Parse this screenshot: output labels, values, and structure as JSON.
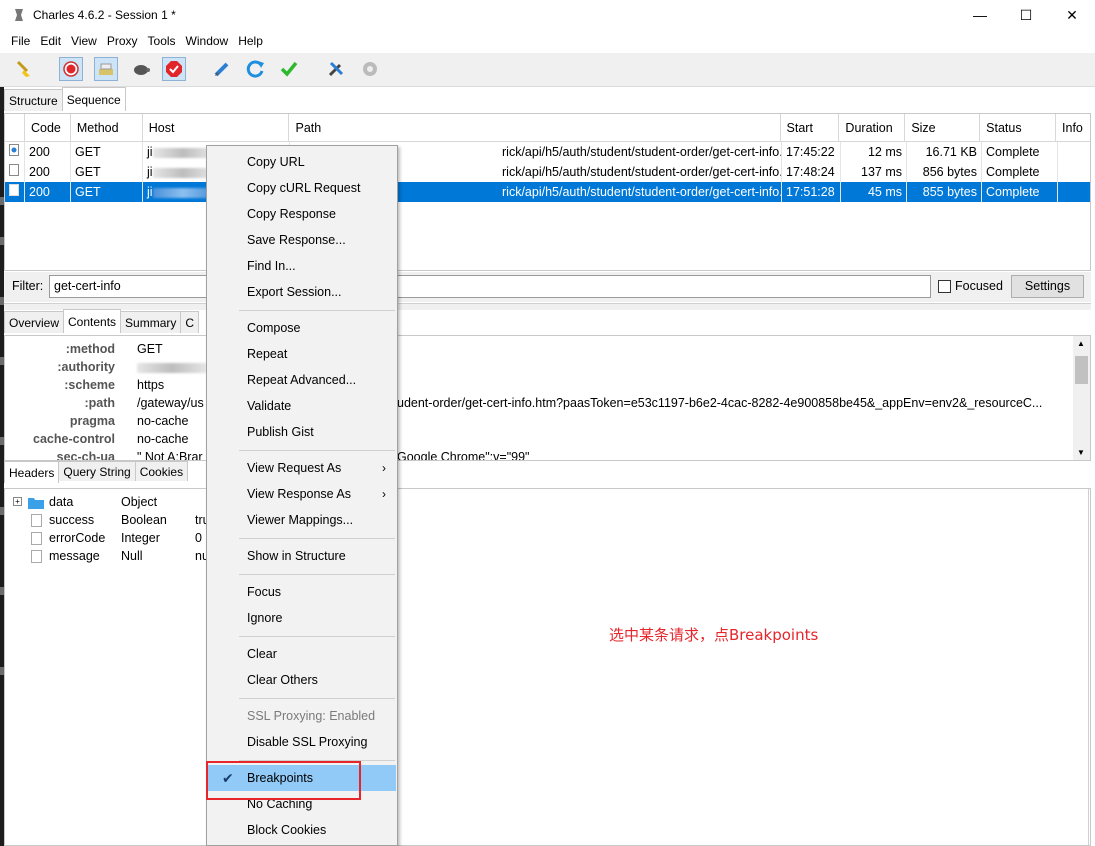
{
  "window": {
    "title": "Charles 4.6.2 - Session 1 *",
    "controls": [
      "—",
      "☐",
      "✕"
    ]
  },
  "menu": [
    "File",
    "Edit",
    "View",
    "Proxy",
    "Tools",
    "Window",
    "Help"
  ],
  "toolbar": {
    "buttons": [
      "broom-icon",
      "record-icon",
      "throttle-icon",
      "turtle-icon",
      "breakpoints-icon",
      "compose-icon",
      "repeat-icon",
      "validate-icon",
      "tools-icon",
      "settings-icon"
    ]
  },
  "main_tabs": [
    "Structure",
    "Sequence"
  ],
  "table": {
    "columns": [
      "Code",
      "Method",
      "Host",
      "Path",
      "Start",
      "Duration",
      "Size",
      "Status",
      "Info"
    ],
    "rows": [
      {
        "code": "200",
        "method": "GET",
        "host": "ji",
        "path": "rick/api/h5/auth/student/student-order/get-cert-info.htm?paasT...",
        "start": "17:45:22",
        "duration": "12 ms",
        "size": "16.71 KB",
        "status": "Complete"
      },
      {
        "code": "200",
        "method": "GET",
        "host": "ji",
        "path": "rick/api/h5/auth/student/student-order/get-cert-info.htm?paasT...",
        "start": "17:48:24",
        "duration": "137 ms",
        "size": "856 bytes",
        "status": "Complete"
      },
      {
        "code": "200",
        "method": "GET",
        "host": "ji",
        "path": "rick/api/h5/auth/student/student-order/get-cert-info.htm?paasT...",
        "start": "17:51:28",
        "duration": "45 ms",
        "size": "855 bytes",
        "status": "Complete"
      }
    ]
  },
  "filter": {
    "label": "Filter:",
    "value": "get-cert-info",
    "focused_label": "Focused",
    "settings_label": "Settings"
  },
  "detail_tabs": [
    "Overview",
    "Contents",
    "Summary",
    "C"
  ],
  "headers": [
    {
      "key": ":method",
      "value": "GET"
    },
    {
      "key": ":authority",
      "value": ""
    },
    {
      "key": ":scheme",
      "value": "https"
    },
    {
      "key": ":path",
      "value": "/gateway/us"
    },
    {
      "key": "pragma",
      "value": "no-cache"
    },
    {
      "key": "cache-control",
      "value": "no-cache"
    },
    {
      "key": "sec-ch-ua",
      "value": "\" Not A;Brar"
    }
  ],
  "header_tail": {
    "path_tail": "udent-order/get-cert-info.htm?paasToken=e53c1197-b6e2-4cac-8282-4e900858be45&_appEnv=env2&_resourceC...",
    "ua_tail": "Google Chrome\";v=\"99\""
  },
  "sub_tabs": [
    "Headers",
    "Query String",
    "Cookies"
  ],
  "tree": [
    {
      "name": "data",
      "type": "Object",
      "value": ""
    },
    {
      "name": "success",
      "type": "Boolean",
      "value": "tru"
    },
    {
      "name": "errorCode",
      "type": "Integer",
      "value": "0"
    },
    {
      "name": "message",
      "type": "Null",
      "value": "nu"
    }
  ],
  "context_menu": [
    {
      "label": "Copy URL"
    },
    {
      "label": "Copy cURL Request"
    },
    {
      "label": "Copy Response"
    },
    {
      "label": "Save Response..."
    },
    {
      "label": "Find In..."
    },
    {
      "label": "Export Session..."
    },
    {
      "label": "Compose"
    },
    {
      "label": "Repeat"
    },
    {
      "label": "Repeat Advanced..."
    },
    {
      "label": "Validate"
    },
    {
      "label": "Publish Gist"
    },
    {
      "label": "View Request As",
      "submenu": true
    },
    {
      "label": "View Response As",
      "submenu": true
    },
    {
      "label": "Viewer Mappings..."
    },
    {
      "label": "Show in Structure"
    },
    {
      "label": "Focus"
    },
    {
      "label": "Ignore"
    },
    {
      "label": "Clear"
    },
    {
      "label": "Clear Others"
    },
    {
      "label": "SSL Proxying: Enabled",
      "disabled": true
    },
    {
      "label": "Disable SSL Proxying"
    },
    {
      "label": "Breakpoints",
      "checked": true,
      "highlighted": true
    },
    {
      "label": "No Caching"
    },
    {
      "label": "Block Cookies"
    }
  ],
  "annotation": "选中某条请求，点Breakpoints",
  "colors": {
    "selection": "#0078d7",
    "menu_highlight": "#91c9f7",
    "annotation_red": "#e5262b"
  }
}
